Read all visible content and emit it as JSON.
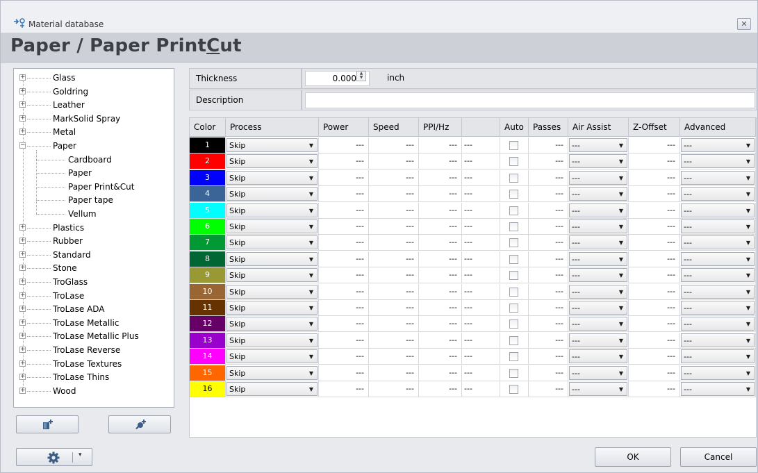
{
  "window": {
    "title": "Material database",
    "close_icon": "✕"
  },
  "heading": {
    "prefix": "Paper / Paper Print",
    "underlined": "C",
    "suffix": "ut"
  },
  "tree": {
    "groups": [
      {
        "label": "Glass",
        "expanded": false
      },
      {
        "label": "Goldring",
        "expanded": false
      },
      {
        "label": "Leather",
        "expanded": false
      },
      {
        "label": "MarkSolid Spray",
        "expanded": false
      },
      {
        "label": "Metal",
        "expanded": false
      },
      {
        "label": "Paper",
        "expanded": true,
        "children": [
          "Cardboard",
          "Paper",
          "Paper Print&Cut",
          "Paper tape",
          "Vellum"
        ]
      },
      {
        "label": "Plastics",
        "expanded": false
      },
      {
        "label": "Rubber",
        "expanded": false
      },
      {
        "label": "Standard",
        "expanded": false
      },
      {
        "label": "Stone",
        "expanded": false
      },
      {
        "label": "TroGlass",
        "expanded": false
      },
      {
        "label": "TroLase",
        "expanded": false
      },
      {
        "label": "TroLase ADA",
        "expanded": false
      },
      {
        "label": "TroLase Metallic",
        "expanded": false
      },
      {
        "label": "TroLase Metallic Plus",
        "expanded": false
      },
      {
        "label": "TroLase Reverse",
        "expanded": false
      },
      {
        "label": "TroLase Textures",
        "expanded": false
      },
      {
        "label": "TroLase Thins",
        "expanded": false
      },
      {
        "label": "Wood",
        "expanded": false
      }
    ],
    "selected": "Paper Print&Cut",
    "expand_glyph": "+",
    "collapse_glyph": "−",
    "add_material_icon": "add-material-icon",
    "add_group_icon": "add-group-icon"
  },
  "settings": {
    "icon": "gear-icon",
    "caret": "▾"
  },
  "properties": {
    "thickness_label": "Thickness",
    "thickness_value": "0.000",
    "thickness_unit": "inch",
    "description_label": "Description",
    "description_value": ""
  },
  "grid": {
    "headers": [
      "Color",
      "Process",
      "Power",
      "Speed",
      "PPI/Hz",
      "",
      "Auto",
      "Passes",
      "Air Assist",
      "Z-Offset",
      "Advanced"
    ],
    "rows": [
      {
        "num": "1",
        "color": "#000000",
        "process": "Skip",
        "power": "---",
        "speed": "---",
        "ppi": "---",
        "ppi_unit": "---",
        "auto": false,
        "passes": "---",
        "air_assist": "---",
        "z_offset": "---",
        "advanced": "---"
      },
      {
        "num": "2",
        "color": "#ff0000",
        "process": "Skip",
        "power": "---",
        "speed": "---",
        "ppi": "---",
        "ppi_unit": "---",
        "auto": false,
        "passes": "---",
        "air_assist": "---",
        "z_offset": "---",
        "advanced": "---"
      },
      {
        "num": "3",
        "color": "#0000ff",
        "process": "Skip",
        "power": "---",
        "speed": "---",
        "ppi": "---",
        "ppi_unit": "---",
        "auto": false,
        "passes": "---",
        "air_assist": "---",
        "z_offset": "---",
        "advanced": "---"
      },
      {
        "num": "4",
        "color": "#3a6596",
        "process": "Skip",
        "power": "---",
        "speed": "---",
        "ppi": "---",
        "ppi_unit": "---",
        "auto": false,
        "passes": "---",
        "air_assist": "---",
        "z_offset": "---",
        "advanced": "---"
      },
      {
        "num": "5",
        "color": "#00ffff",
        "process": "Skip",
        "power": "---",
        "speed": "---",
        "ppi": "---",
        "ppi_unit": "---",
        "auto": false,
        "passes": "---",
        "air_assist": "---",
        "z_offset": "---",
        "advanced": "---"
      },
      {
        "num": "6",
        "color": "#00ff00",
        "process": "Skip",
        "power": "---",
        "speed": "---",
        "ppi": "---",
        "ppi_unit": "---",
        "auto": false,
        "passes": "---",
        "air_assist": "---",
        "z_offset": "---",
        "advanced": "---"
      },
      {
        "num": "7",
        "color": "#009933",
        "process": "Skip",
        "power": "---",
        "speed": "---",
        "ppi": "---",
        "ppi_unit": "---",
        "auto": false,
        "passes": "---",
        "air_assist": "---",
        "z_offset": "---",
        "advanced": "---"
      },
      {
        "num": "8",
        "color": "#006633",
        "process": "Skip",
        "power": "---",
        "speed": "---",
        "ppi": "---",
        "ppi_unit": "---",
        "auto": false,
        "passes": "---",
        "air_assist": "---",
        "z_offset": "---",
        "advanced": "---"
      },
      {
        "num": "9",
        "color": "#999933",
        "process": "Skip",
        "power": "---",
        "speed": "---",
        "ppi": "---",
        "ppi_unit": "---",
        "auto": false,
        "passes": "---",
        "air_assist": "---",
        "z_offset": "---",
        "advanced": "---"
      },
      {
        "num": "10",
        "color": "#996633",
        "process": "Skip",
        "power": "---",
        "speed": "---",
        "ppi": "---",
        "ppi_unit": "---",
        "auto": false,
        "passes": "---",
        "air_assist": "---",
        "z_offset": "---",
        "advanced": "---"
      },
      {
        "num": "11",
        "color": "#663300",
        "process": "Skip",
        "power": "---",
        "speed": "---",
        "ppi": "---",
        "ppi_unit": "---",
        "auto": false,
        "passes": "---",
        "air_assist": "---",
        "z_offset": "---",
        "advanced": "---"
      },
      {
        "num": "12",
        "color": "#660066",
        "process": "Skip",
        "power": "---",
        "speed": "---",
        "ppi": "---",
        "ppi_unit": "---",
        "auto": false,
        "passes": "---",
        "air_assist": "---",
        "z_offset": "---",
        "advanced": "---"
      },
      {
        "num": "13",
        "color": "#9900cc",
        "process": "Skip",
        "power": "---",
        "speed": "---",
        "ppi": "---",
        "ppi_unit": "---",
        "auto": false,
        "passes": "---",
        "air_assist": "---",
        "z_offset": "---",
        "advanced": "---"
      },
      {
        "num": "14",
        "color": "#ff00ff",
        "process": "Skip",
        "power": "---",
        "speed": "---",
        "ppi": "---",
        "ppi_unit": "---",
        "auto": false,
        "passes": "---",
        "air_assist": "---",
        "z_offset": "---",
        "advanced": "---"
      },
      {
        "num": "15",
        "color": "#ff6600",
        "process": "Skip",
        "power": "---",
        "speed": "---",
        "ppi": "---",
        "ppi_unit": "---",
        "auto": false,
        "passes": "---",
        "air_assist": "---",
        "z_offset": "---",
        "advanced": "---"
      },
      {
        "num": "16",
        "color": "#ffff00",
        "process": "Skip",
        "power": "---",
        "speed": "---",
        "ppi": "---",
        "ppi_unit": "---",
        "auto": false,
        "passes": "---",
        "air_assist": "---",
        "z_offset": "---",
        "advanced": "---"
      }
    ],
    "dropdown_glyph": "▼"
  },
  "footer": {
    "ok_label": "OK",
    "cancel_label": "Cancel"
  }
}
